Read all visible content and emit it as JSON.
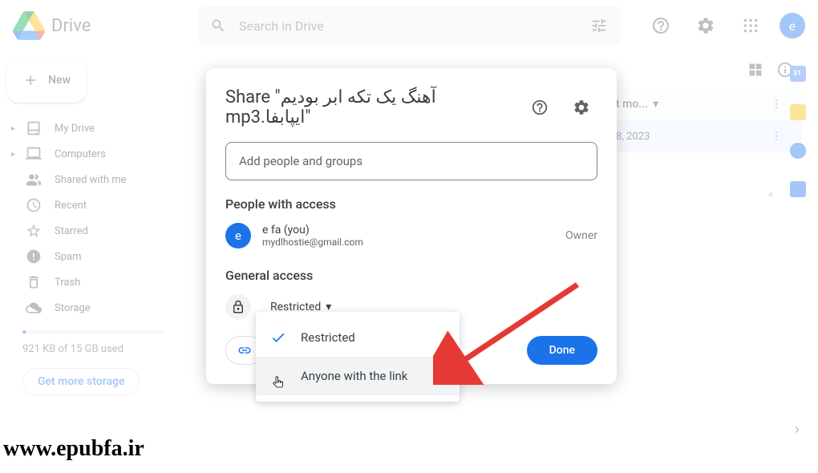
{
  "header": {
    "app_name": "Drive",
    "search_placeholder": "Search in Drive",
    "avatar_letter": "e"
  },
  "sidebar": {
    "new_label": "New",
    "items": [
      {
        "label": "My Drive",
        "icon": "mydrive",
        "expandable": true
      },
      {
        "label": "Computers",
        "icon": "computers",
        "expandable": true
      },
      {
        "label": "Shared with me",
        "icon": "shared"
      },
      {
        "label": "Recent",
        "icon": "recent"
      },
      {
        "label": "Starred",
        "icon": "starred"
      },
      {
        "label": "Spam",
        "icon": "spam"
      },
      {
        "label": "Trash",
        "icon": "trash"
      },
      {
        "label": "Storage",
        "icon": "storage"
      }
    ],
    "storage_used": "921 KB of 15 GB used",
    "get_storage": "Get more storage"
  },
  "table": {
    "header_lastmod": "t mo...",
    "row_date": "8, 2023"
  },
  "modal": {
    "title_prefix": "Share \"",
    "title_filename": "آهنگ یک تکه ابر بودیم ایپابفا.mp3",
    "title_suffix": "\"",
    "add_placeholder": "Add people and groups",
    "people_heading": "People with access",
    "person_name": "e fa (you)",
    "person_email": "mydlhostie@gmail.com",
    "person_role": "Owner",
    "general_heading": "General access",
    "access_level": "Restricted",
    "done": "Done"
  },
  "dropdown": {
    "option_restricted": "Restricted",
    "option_anyone": "Anyone with the link"
  },
  "watermark": "www.epubfa.ir"
}
